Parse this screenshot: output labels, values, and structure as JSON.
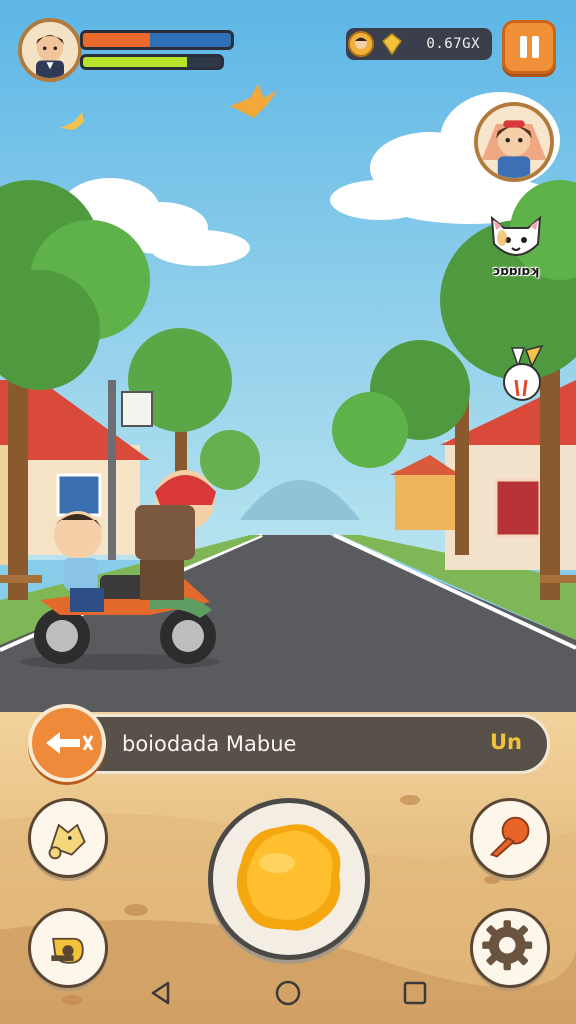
{
  "hud": {
    "player_avatar": "boy-portrait-icon",
    "health_bar": {
      "level": 0.45,
      "color": "#ea6a2c",
      "rest_color": "#2f6fb8"
    },
    "energy_bar": {
      "level": 0.75,
      "color": "#b7e32a",
      "rest_color": "#2a2f3a"
    },
    "currency": {
      "coin_icon": "coin-face-icon",
      "gem_icon": "gem-icon",
      "amount": "0.67GX"
    },
    "pause_icon": "pause-icon"
  },
  "side_panel": {
    "friend_avatar": "girl-portrait-icon",
    "cat_badge_icon": "cat-face-icon",
    "cat_label": "ɔɒɒıɒʞ",
    "bunny_badge_icon": "bunny-icon"
  },
  "banner": {
    "button_icon": "arrow-left-icon",
    "location_text": "boiodada Mabue",
    "tag_text": "Un"
  },
  "controls": {
    "left_top_icon": "fox-mask-icon",
    "left_bottom_icon": "whistle-icon",
    "center_icon": "action-orb-icon",
    "right_top_icon": "ice-cream-icon",
    "right_bottom_icon": "gear-icon"
  },
  "nav": {
    "back_icon": "back-triangle-icon",
    "home_icon": "home-circle-icon",
    "recents_icon": "recents-square-icon"
  },
  "colors": {
    "sky": "#87cdea",
    "road": "#5a5b5e",
    "ground": "#e9c28a",
    "accent_orange": "#ef8a3a"
  }
}
